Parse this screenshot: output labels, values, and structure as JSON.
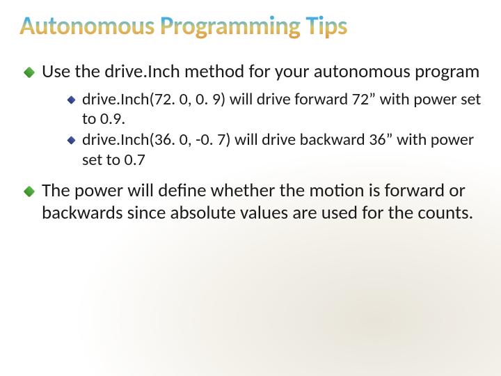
{
  "title": "Autonomous Programming Tips",
  "bullets": [
    {
      "text": "Use the drive.Inch method for your autonomous program",
      "sub": [
        "drive.Inch(72. 0, 0. 9) will drive forward 72” with power set to 0.9.",
        "drive.Inch(36. 0, -0. 7) will drive backward 36” with power set to 0.7"
      ]
    },
    {
      "text": "The power will define whether the motion is forward or backwards since absolute values are used for the counts.",
      "sub": []
    }
  ]
}
